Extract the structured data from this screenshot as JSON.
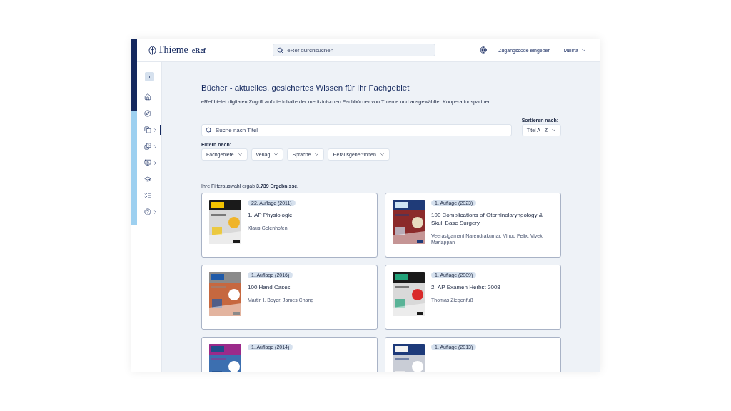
{
  "header": {
    "logo": "Thieme",
    "product": "eRef",
    "search_placeholder": "eRef durchsuchen",
    "access_link": "Zugangscode eingeben",
    "user": "Melina"
  },
  "sidebar": {
    "items": [
      {
        "expandable": false,
        "selected": false
      },
      {
        "expandable": false,
        "selected": false
      },
      {
        "expandable": true,
        "selected": true
      },
      {
        "expandable": true,
        "selected": false
      },
      {
        "expandable": true,
        "selected": false
      },
      {
        "expandable": false,
        "selected": false
      },
      {
        "expandable": false,
        "selected": false
      },
      {
        "expandable": true,
        "selected": false
      }
    ]
  },
  "main": {
    "title": "Bücher - aktuelles, gesichertes Wissen für Ihr Fachgebiet",
    "intro": "eRef bietet digitalen Zugriff auf die Inhalte der medizinischen Fachbücher von Thieme und ausgewählter Kooperationspartner.",
    "search_placeholder": "Suche nach Titel",
    "sort_label": "Sortieren nach:",
    "sort_value": "Titel A - Z",
    "filter_label": "Filtern nach:",
    "filters": [
      "Fachgebiete",
      "Verlag",
      "Sprache",
      "Herausgeber*innen"
    ],
    "results": "Ihre Filterauswahl ergab **3.739 Ergebnisse.**",
    "books": [
      {
        "edition": "22. Auflage (2011)",
        "title": "1. ÄP Physiologie",
        "authors": "Klaus Golenhofen"
      },
      {
        "edition": "1. Auflage (2023)",
        "title": "100 Complications of Otorhinolaryngology & Skull Base Surgery",
        "authors": "Veerasigamani Narendrakumar, Vinod Felix, Vivek Mariappan"
      },
      {
        "edition": "1. Auflage (2016)",
        "title": "100 Hand Cases",
        "authors": "Martin I. Boyer, James Chang"
      },
      {
        "edition": "1. Auflage (2009)",
        "title": "2. ÄP Examen Herbst 2008",
        "authors": "Thomas Ziegenfuß"
      },
      {
        "edition": "1. Auflage (2014)"
      },
      {
        "edition": "1. Auflage (2013)"
      }
    ]
  }
}
